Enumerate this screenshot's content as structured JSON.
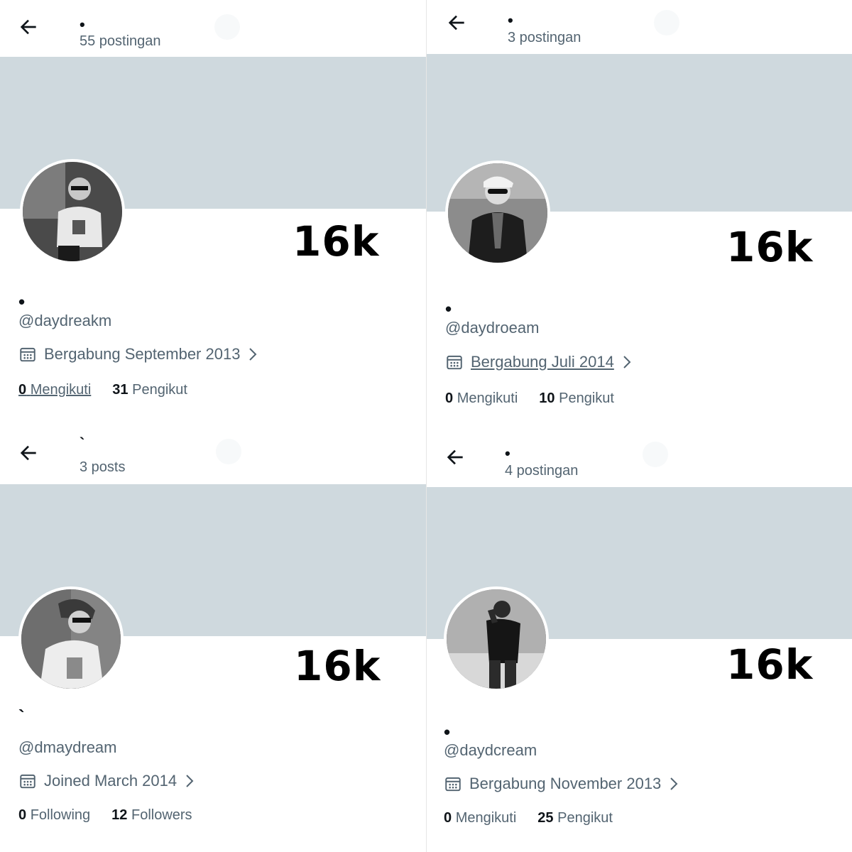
{
  "profiles": [
    {
      "display_name": "•",
      "post_count": "55 postingan",
      "big_count": "16k",
      "handle": "@daydreakm",
      "joined": "Bergabung September 2013",
      "following_count": "0",
      "following_label": "Mengikuti",
      "followers_count": "31",
      "followers_label": "Pengikut"
    },
    {
      "display_name": "•",
      "post_count": "3 postingan",
      "big_count": "16k",
      "handle": "@daydroeam",
      "joined": "Bergabung Juli 2014",
      "following_count": "0",
      "following_label": "Mengikuti",
      "followers_count": "10",
      "followers_label": "Pengikut"
    },
    {
      "display_name": "`",
      "post_count": "3 posts",
      "big_count": "16k",
      "handle": "@dmaydream",
      "joined": "Joined March 2014",
      "following_count": "0",
      "following_label": "Following",
      "followers_count": "12",
      "followers_label": "Followers"
    },
    {
      "display_name": "•",
      "post_count": "4 postingan",
      "big_count": "16k",
      "handle": "@daydcream",
      "joined": "Bergabung November 2013",
      "following_count": "0",
      "following_label": "Mengikuti",
      "followers_count": "25",
      "followers_label": "Pengikut"
    }
  ],
  "icons": {
    "back": "arrow-left-icon",
    "calendar": "calendar-icon",
    "chevron": "chevron-right-icon"
  },
  "colors": {
    "banner": "#cfd9de",
    "secondary_text": "#536471",
    "primary_text": "#0f1419"
  }
}
